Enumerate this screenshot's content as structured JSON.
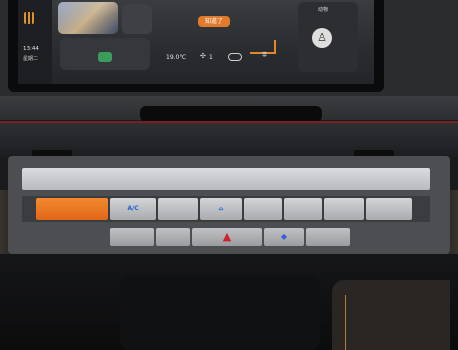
{
  "screen": {
    "left_panel": {
      "time": "13:44",
      "date": "星期二"
    },
    "notice_button": "知道了",
    "climate_bar": {
      "seat_temp": "19.0℃",
      "fan_icon": "fan-icon",
      "fan_level": "1",
      "recirc_icon": "recirculation-icon",
      "defrost_icon": "defrost-icon"
    },
    "top_right_label": "动物",
    "seat_icon": "seat-icon"
  },
  "control_panel": {
    "buttons": [
      {
        "name": "orange-button",
        "label": "",
        "color": "#f07a22"
      },
      {
        "name": "ac-button",
        "label": "A/C"
      },
      {
        "name": "blank-button-1",
        "label": ""
      },
      {
        "name": "recirc-button",
        "label": "",
        "icon": "car-recirc-icon",
        "color": "#1c66d6"
      },
      {
        "name": "blank-button-2",
        "label": ""
      },
      {
        "name": "blank-button-3",
        "label": ""
      },
      {
        "name": "blank-button-4",
        "label": ""
      },
      {
        "name": "blank-button-5",
        "label": ""
      }
    ],
    "lower_buttons": [
      {
        "name": "lower-button-1",
        "label": ""
      },
      {
        "name": "lower-button-2",
        "label": ""
      },
      {
        "name": "hazard-button",
        "label": "▲",
        "color": "#d21e2b"
      },
      {
        "name": "led-button",
        "label": "◆",
        "color": "#3a5ee0"
      },
      {
        "name": "lower-button-5",
        "label": ""
      }
    ]
  },
  "colors": {
    "accent_orange": "#e07b2d",
    "ac_blue": "#1c66d6",
    "hazard_red": "#d21e2b"
  }
}
